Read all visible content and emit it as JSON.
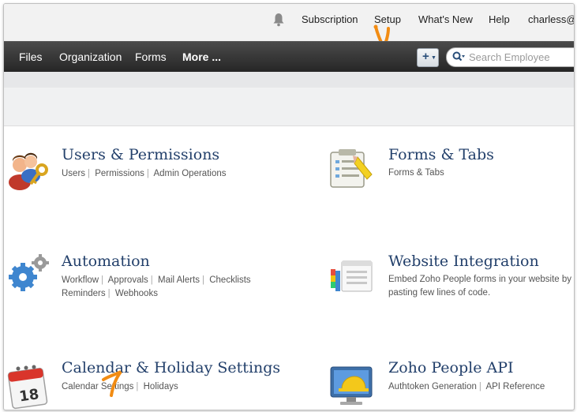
{
  "topbar": {
    "links": [
      "Subscription",
      "Setup",
      "What's New",
      "Help"
    ],
    "user": "charless@"
  },
  "navbar": {
    "items": [
      "Files",
      "Organization",
      "Forms",
      "More ..."
    ],
    "add_button_label": "+",
    "search_placeholder": "Search Employee"
  },
  "cards": {
    "users": {
      "title": "Users & Permissions",
      "links": [
        "Users",
        "Permissions",
        "Admin Operations"
      ]
    },
    "forms": {
      "title": "Forms & Tabs",
      "links": [
        "Forms & Tabs"
      ]
    },
    "automation": {
      "title": "Automation",
      "links_line1": [
        "Workflow",
        "Approvals",
        "Mail Alerts",
        "Checklists"
      ],
      "links_line2": [
        "Reminders",
        "Webhooks"
      ]
    },
    "website": {
      "title": "Website Integration",
      "description": "Embed Zoho People forms in your website by pasting few lines of code."
    },
    "calendar": {
      "title": "Calendar & Holiday Settings",
      "links": [
        "Calendar Settings",
        "Holidays"
      ]
    },
    "api": {
      "title": "Zoho People API",
      "links": [
        "Authtoken Generation",
        "API Reference"
      ]
    }
  },
  "icons": {
    "bell": "bell-icon",
    "search": "search-icon",
    "users": "users-key-icon",
    "forms": "forms-clipboard-icon",
    "automation": "gears-icon",
    "website": "website-form-icon",
    "calendar": "calendar-icon",
    "api": "api-monitor-icon"
  },
  "colors": {
    "title": "#23406b",
    "navbar": "#2e2e2e",
    "cursor": "#f28c13"
  }
}
